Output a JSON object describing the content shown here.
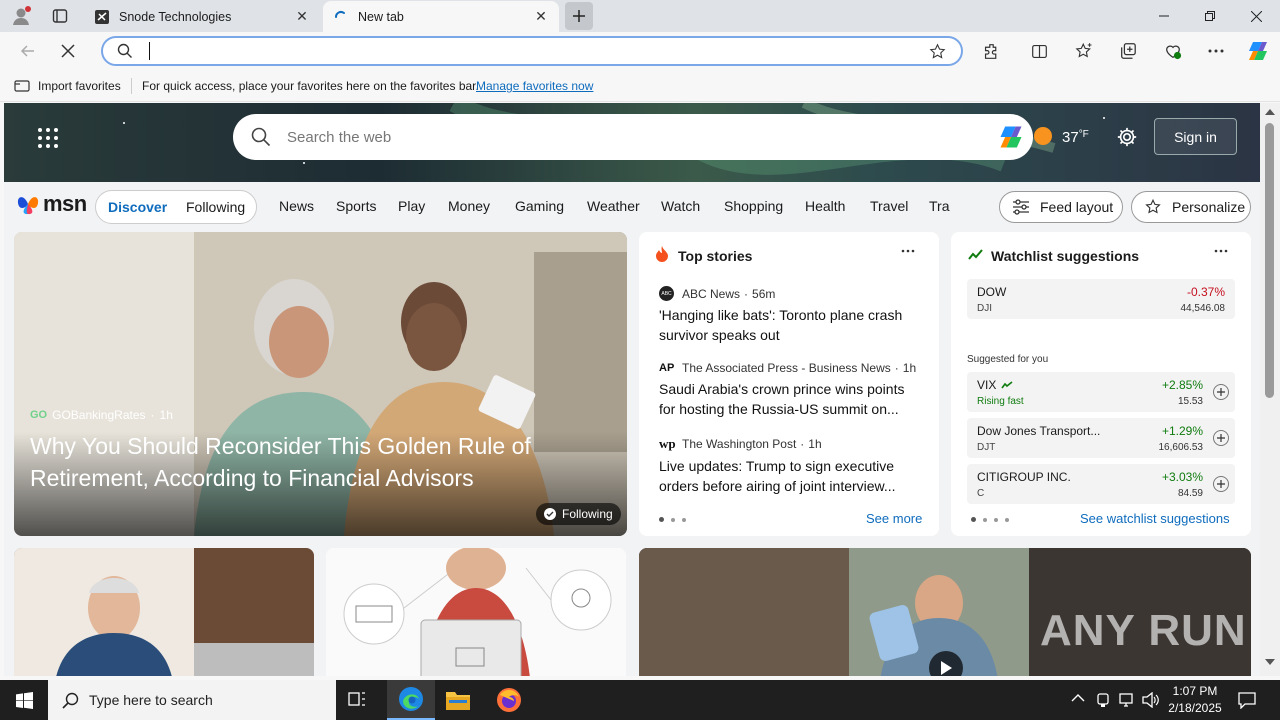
{
  "browser": {
    "tabs": [
      {
        "label": "Snode Technologies",
        "state": "inactive"
      },
      {
        "label": "New tab",
        "state": "active"
      }
    ],
    "address_value": "",
    "favorites_bar": {
      "import_label": "Import favorites",
      "hint": "For quick access, place your favorites here on the favorites bar.",
      "manage_link": "Manage favorites now"
    }
  },
  "msn": {
    "search_placeholder": "Search the web",
    "temperature": "37",
    "temp_unit": "°F",
    "sign_in": "Sign in",
    "logo_text": "msn",
    "toggle": [
      "Discover",
      "Following"
    ],
    "nav": [
      "News",
      "Sports",
      "Play",
      "Money",
      "Gaming",
      "Weather",
      "Watch",
      "Shopping",
      "Health",
      "Travel",
      "Tra"
    ],
    "feed_layout": "Feed layout",
    "personalize": "Personalize"
  },
  "hero": {
    "source_logo": "GO",
    "source": "GOBankingRates",
    "age": "1h",
    "headline": "Why You Should Reconsider This Golden Rule of Retirement, According to Financial Advisors",
    "following_badge": "Following"
  },
  "top_stories": {
    "title": "Top stories",
    "items": [
      {
        "logo": "ABC",
        "source": "ABC News",
        "age": "56m",
        "headline": "'Hanging like bats': Toronto plane crash survivor speaks out"
      },
      {
        "logo": "AP",
        "source": "The Associated Press - Business News",
        "age": "1h",
        "headline": "Saudi Arabia's crown prince wins points for hosting the Russia-US summit on..."
      },
      {
        "logo": "wp",
        "source": "The Washington Post",
        "age": "1h",
        "headline": "Live updates: Trump to sign executive orders before airing of joint interview..."
      }
    ],
    "see_more": "See more"
  },
  "watchlist": {
    "title": "Watchlist suggestions",
    "main": {
      "name": "DOW",
      "symbol": "DJI",
      "change": "-0.37%",
      "price": "44,546.08"
    },
    "suggested_label": "Suggested for you",
    "suggestions": [
      {
        "name": "VIX",
        "symbol": "Rising fast",
        "change": "+2.85%",
        "price": "15.53"
      },
      {
        "name": "Dow Jones Transport...",
        "symbol": "DJT",
        "change": "+1.29%",
        "price": "16,606.53"
      },
      {
        "name": "CITIGROUP INC.",
        "symbol": "C",
        "change": "+3.03%",
        "price": "84.59"
      }
    ],
    "see_link": "See watchlist suggestions"
  },
  "watermark": "ANY RUN",
  "taskbar": {
    "search_placeholder": "Type here to search",
    "time": "1:07 PM",
    "date": "2/18/2025"
  },
  "colors": {
    "accent": "#0f6cbd",
    "negative": "#c50f1f",
    "positive": "#107c10",
    "taskbar": "#1f1f1f"
  }
}
